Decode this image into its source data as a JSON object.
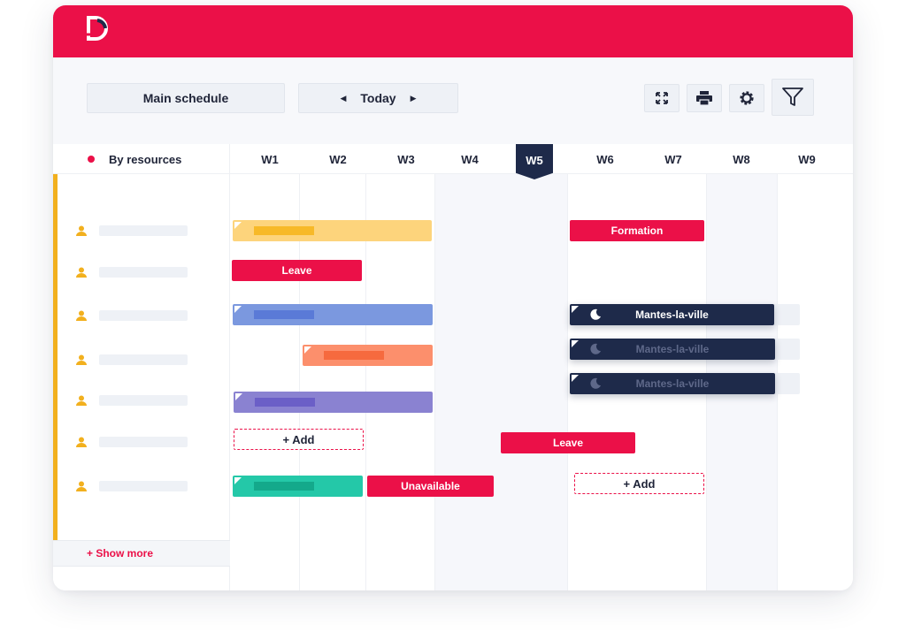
{
  "toolbar": {
    "main_schedule_label": "Main schedule",
    "today_label": "Today",
    "icons": [
      "expand-icon",
      "print-icon",
      "gear-icon",
      "filter-icon"
    ]
  },
  "grid": {
    "resources_header": "By resources",
    "weeks": [
      "W1",
      "W2",
      "W3",
      "W4",
      "W5",
      "W6",
      "W7",
      "W8",
      "W9"
    ],
    "current_week": "W5",
    "show_more_label": "+ Show more"
  },
  "events": {
    "formation": "Formation",
    "leave": "Leave",
    "unavailable": "Unavailable",
    "mantes": "Mantes-la-ville",
    "add": "+ Add"
  },
  "colors": {
    "brand": "#eb1048",
    "navy": "#1e2a4a",
    "yellow": "#fdd47c",
    "blue": "#7b98df",
    "orange": "#fc8f6c",
    "purple": "#8a82d1",
    "teal": "#24c8a8",
    "accent": "#f2b01e"
  }
}
